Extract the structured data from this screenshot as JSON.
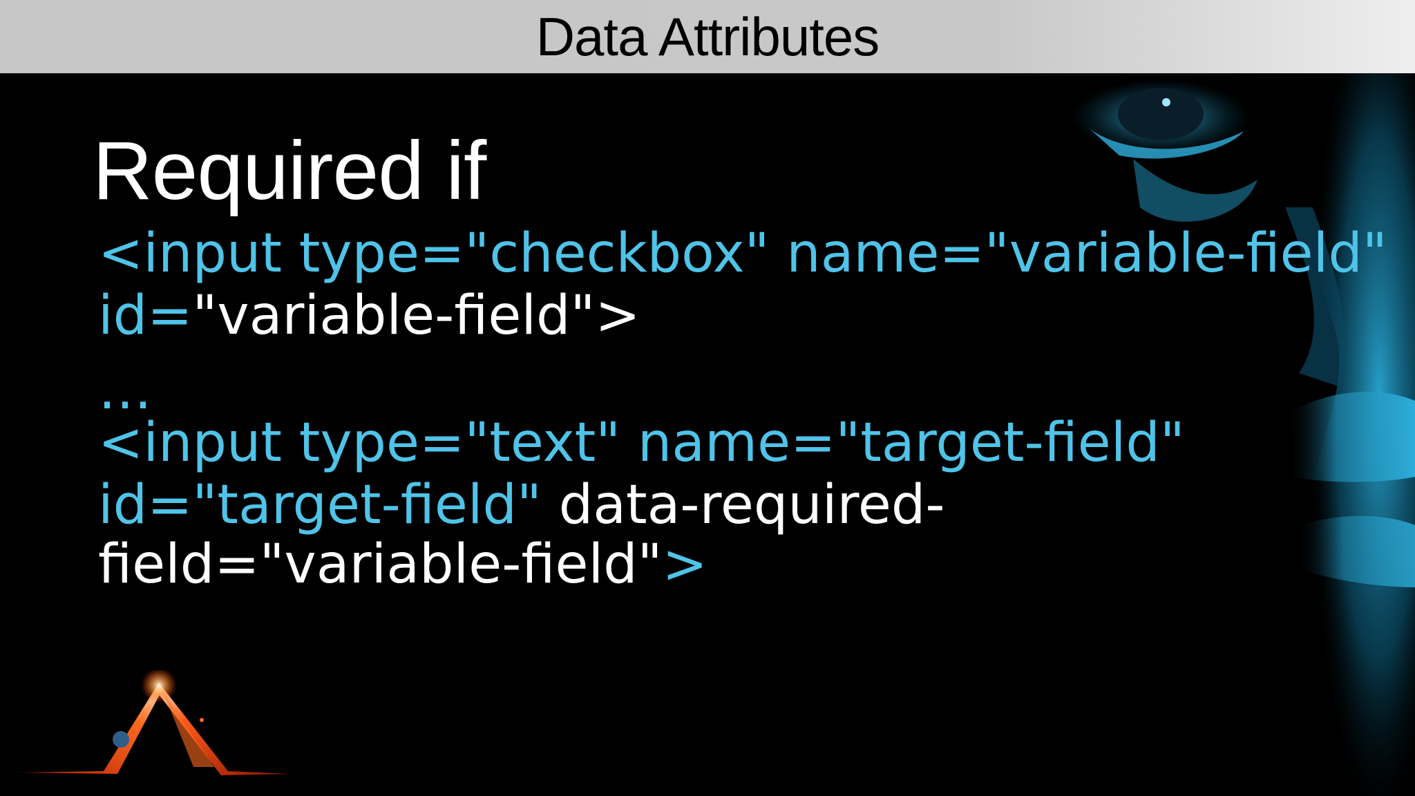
{
  "header": {
    "title": "Data Attributes"
  },
  "slide": {
    "heading": "Required if",
    "code": {
      "line1": "<input type=\"checkbox\" name=\"variable-field\"",
      "line2_attr": "id=",
      "line2_value": "\"variable-field\">",
      "line3": "…",
      "line4": "<input type=\"text\" name=\"target-field\"",
      "line5_attr": "id=\"target-field\"",
      "line5_data": " data-required-",
      "line6_value": "field=\"variable-field\"",
      "line6_close": ">"
    }
  },
  "colors": {
    "header_bg": "#c8c8c8",
    "background": "#000000",
    "code_cyan": "#4fc3e8",
    "text_white": "#ffffff",
    "logo_glow": "#ff5a1a"
  },
  "icons": {
    "logo": "glowing-triangle-logo",
    "face": "cyan-face-artwork"
  }
}
